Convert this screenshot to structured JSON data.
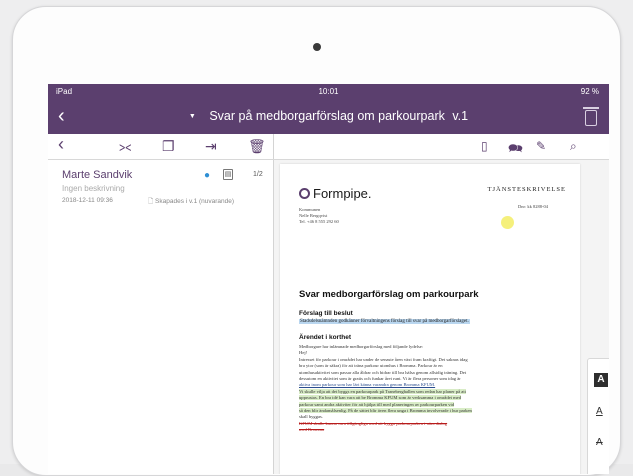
{
  "status_bar": {
    "device": "iPad",
    "time": "10:01",
    "battery": "92 %"
  },
  "title_bar": {
    "title": "Svar på medborgarförslag om parkourpark",
    "version": "v.1"
  },
  "left_toolbar": {
    "icons": [
      "chevron-left-icon",
      "share-icon",
      "copy-icon",
      "export-icon",
      "trash-icon"
    ]
  },
  "document_item": {
    "author": "Marte Sandvik",
    "description": "Ingen beskrivning",
    "pages": "1/2",
    "date": "2018-12-11 09:36",
    "created": "Skapades i v.1 (nuvarande)"
  },
  "right_toolbar": {
    "icons": [
      "document-icon",
      "comments-icon",
      "edit-icon",
      "search-icon"
    ]
  },
  "doc": {
    "logo": "Formpipe.",
    "type": "TJÄNSTESKRIVELSE",
    "dnr": "Dnr: kk 8288-04",
    "sender_lines": [
      "Kommunen",
      "Nelle Bergqvist",
      "Tel. +46 8 555 292 60"
    ],
    "heading": "Svar medborgarförslag om parkourpark",
    "section1": "Förslag till beslut",
    "section1_text": "Stadsdelsnämnden godkänner förvaltningens förslag till svar på medborgarförslaget.",
    "section2": "Ärendet i korthet",
    "body_plain_1": "Medborgare har inlämnade medborgarförslag med följande lydelse:",
    "body_plain_2": "Hej!",
    "body_plain_3": "Intresset för parkour i området har under de senaste åren växt fram kraftigt. Det saknas idag",
    "body_plain_4": "bra ytor (som är säkra) för att träna parkour utomhus i Bromma. Parkour är en",
    "body_plain_5": "utomhusaktivitet som passar alla åldrar och bidrar till bra hälsa genom allsidig träning. Det",
    "body_plain_6": "dessutom en aktivitet som är gratis och funkar året runt. Vi är flera personer som idag är",
    "body_u_1": "aktiva inom parkour som har lärt känna varandra genom Bromma KFUM.",
    "body_g_1": "Vi skulle vilja att det byggs en parkourpark på Traneberghallen som redan har planer på att",
    "body_g_2": "upprustas. En bra idé kan vara att be Bromma KFUM som är verksamma i området med",
    "body_g_3": "parkour samt andra aktiviter för att hjälpa till med planeringen av parkourparken vid",
    "body_g_4": "så den blir ändamålsenlig. På de sättet blir även flera unga i Bromma involverade i hur parken",
    "body_plain_7": "skall byggas.",
    "body_r_1": "KFUM skulle kunna vara tillgängliga med att bygga parkourparken i nära dialog",
    "body_r_2": "med Bromma"
  },
  "side_tools": {
    "tool1": "A",
    "tool2": "A",
    "tool3": "A"
  }
}
